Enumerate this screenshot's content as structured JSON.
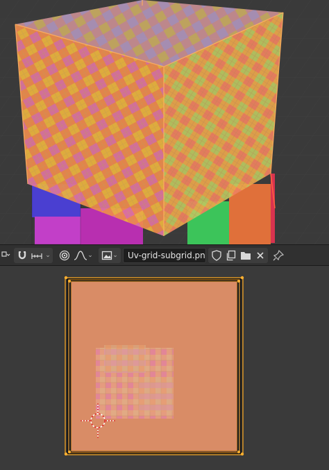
{
  "viewport": {
    "background": "#3a3a3a",
    "grid_color": "#2f2f2f",
    "box_texture_colors": [
      "#f08a4b",
      "#e9b23c",
      "#de6fa0",
      "#a8c95e"
    ],
    "bottom_tile_colors": [
      "#4a3fd1",
      "#c23fc8",
      "#d9334f",
      "#3cc45a",
      "#e0703a"
    ]
  },
  "toolbar": {
    "snap_icon": "magnet-icon",
    "snap_target_icon": "snap-increment-icon",
    "proportional_icon": "proportional-edit-icon",
    "falloff_icon": "falloff-curve-icon",
    "image_icon": "image-browse-icon",
    "image_name": "Uv-grid-subgrid.png",
    "fake_user_icon": "shield-icon",
    "new_image_icon": "duplicate-icon",
    "open_image_icon": "folder-icon",
    "unlink_icon": "close-icon",
    "pin_icon": "pin-icon",
    "active_color": "#5680c2"
  },
  "uv_editor": {
    "background": "#3a3a3a",
    "image_fill": "#d98c66",
    "uv_border_color": "#f0a020",
    "cursor_icon": "2d-cursor-icon"
  }
}
